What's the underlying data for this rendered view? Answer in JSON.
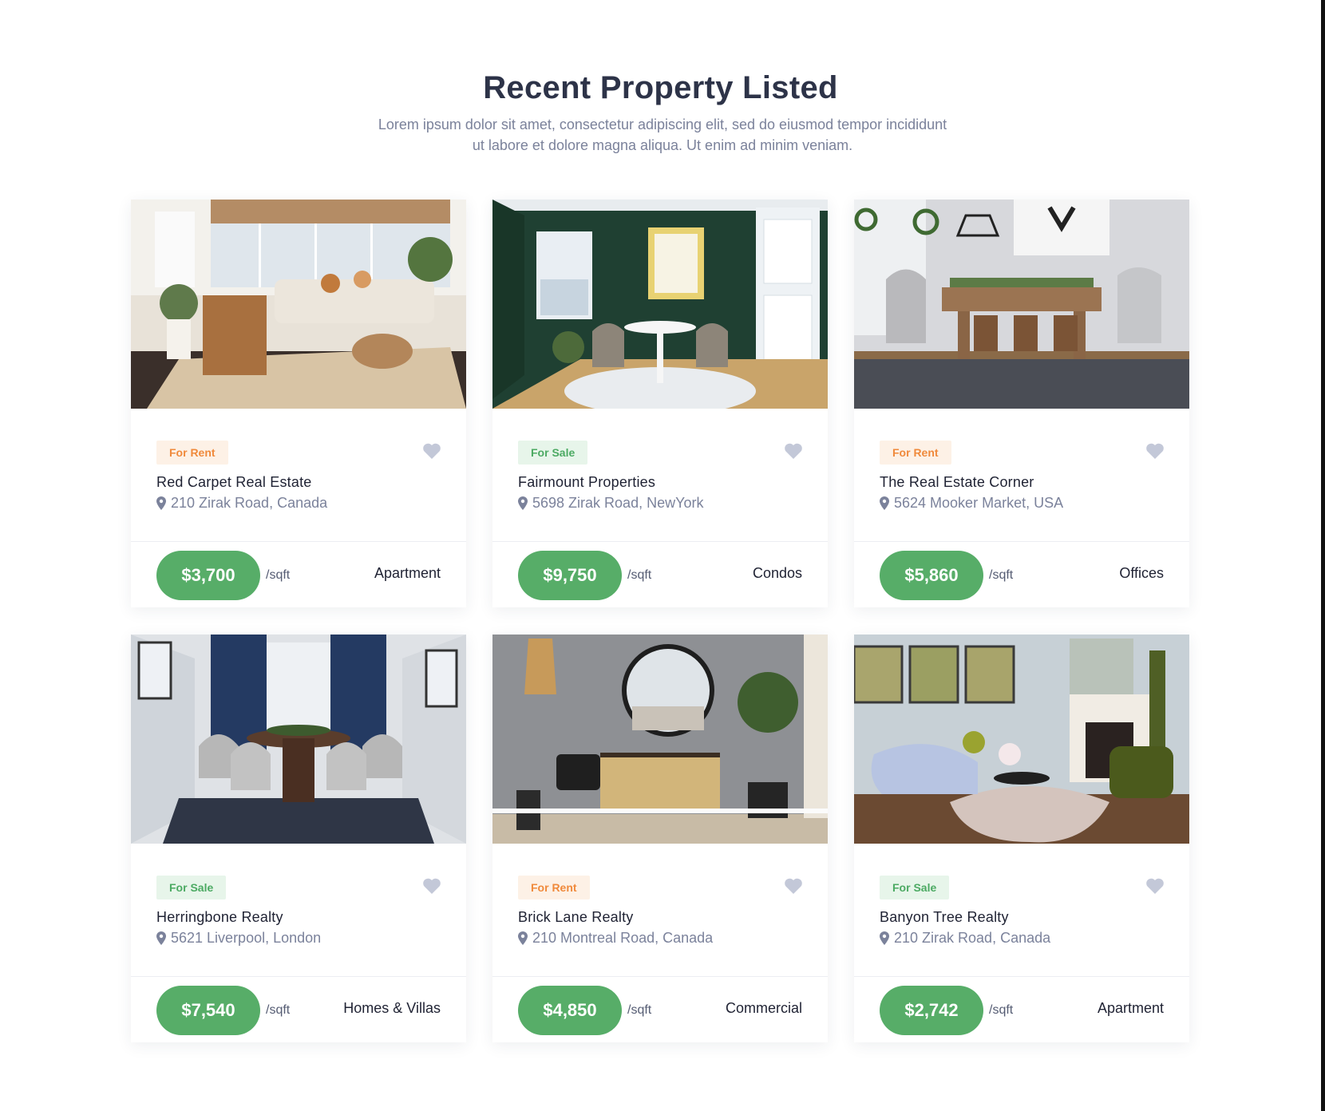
{
  "section": {
    "title": "Recent Property Listed",
    "subtitle_line1": "Lorem ipsum dolor sit amet, consectetur adipiscing elit, sed do eiusmod tempor incididunt",
    "subtitle_line2": "ut labore et dolore magna aliqua. Ut enim ad minim veniam."
  },
  "colors": {
    "price_green": "#57ad68",
    "rent_badge_text": "#f08a3c",
    "sale_badge_text": "#4caa63",
    "heart": "#c3c8d8",
    "title": "#2d3348"
  },
  "cards": [
    {
      "status": "For Rent",
      "status_kind": "rent",
      "name": "Red Carpet Real Estate",
      "address": "210 Zirak Road, Canada",
      "price": "$3,700",
      "unit": "/sqft",
      "type": "Apartment",
      "image": "living-room-photo"
    },
    {
      "status": "For Sale",
      "status_kind": "sale",
      "name": "Fairmount Properties",
      "address": "5698 Zirak Road, NewYork",
      "price": "$9,750",
      "unit": "/sqft",
      "type": "Condos",
      "image": "green-dining-room-photo"
    },
    {
      "status": "For Rent",
      "status_kind": "rent",
      "name": "The Real Estate Corner",
      "address": "5624 Mooker Market, USA",
      "price": "$5,860",
      "unit": "/sqft",
      "type": "Offices",
      "image": "dining-table-photo"
    },
    {
      "status": "For Sale",
      "status_kind": "sale",
      "name": "Herringbone Realty",
      "address": "5621 Liverpool, London",
      "price": "$7,540",
      "unit": "/sqft",
      "type": "Homes & Villas",
      "image": "round-dining-room-photo"
    },
    {
      "status": "For Rent",
      "status_kind": "rent",
      "name": "Brick Lane Realty",
      "address": "210 Montreal Road, Canada",
      "price": "$4,850",
      "unit": "/sqft",
      "type": "Commercial",
      "image": "entryway-mirror-photo"
    },
    {
      "status": "For Sale",
      "status_kind": "sale",
      "name": "Banyon Tree Realty",
      "address": "210 Zirak Road, Canada",
      "price": "$2,742",
      "unit": "/sqft",
      "type": "Apartment",
      "image": "blue-sofa-living-room-photo"
    }
  ]
}
